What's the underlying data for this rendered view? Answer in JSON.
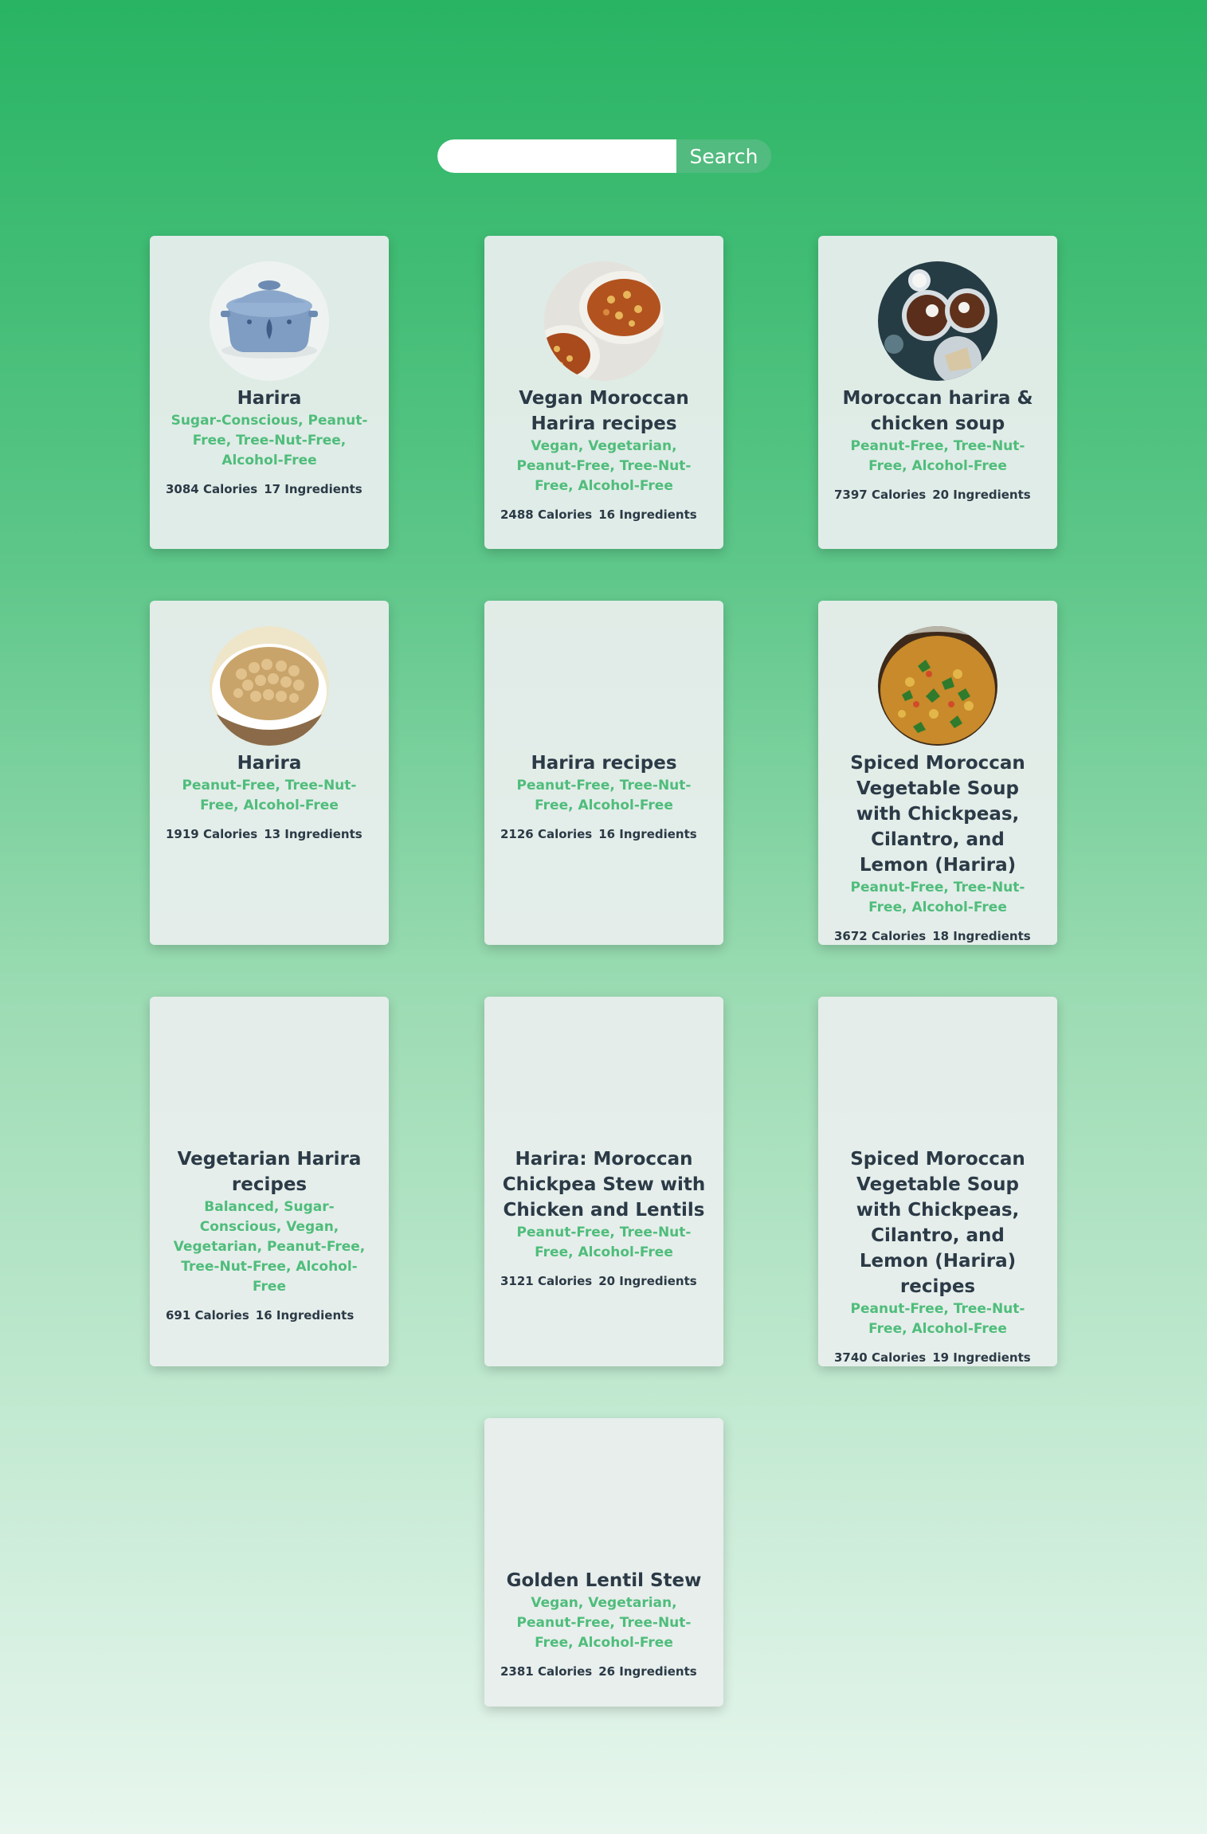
{
  "search": {
    "input_value": "",
    "placeholder": "",
    "button_label": "Search"
  },
  "colors": {
    "background_top": "#28b463",
    "background_bottom": "#e8f6ee",
    "accent_green": "#4fbd7b",
    "title_text": "#2b3a46",
    "card_background": "#e9eeed"
  },
  "recipes": [
    {
      "title": "Harira",
      "tags": "Sugar-Conscious, Peanut-Free, Tree-Nut-Free, Alcohol-Free",
      "calories": "3084 Calories",
      "ingredients": "17 Ingredients",
      "image": "blue-casserole-pot"
    },
    {
      "title": "Vegan Moroccan Harira recipes",
      "tags": "Vegan, Vegetarian, Peanut-Free, Tree-Nut-Free, Alcohol-Free",
      "calories": "2488 Calories",
      "ingredients": "16 Ingredients",
      "image": "chickpea-stew-bowls"
    },
    {
      "title": "Moroccan harira & chicken soup",
      "tags": "Peanut-Free, Tree-Nut-Free, Alcohol-Free",
      "calories": "7397 Calories",
      "ingredients": "20 Ingredients",
      "image": "soup-bowls-overhead"
    },
    {
      "title": "Harira",
      "tags": "Peanut-Free, Tree-Nut-Free, Alcohol-Free",
      "calories": "1919 Calories",
      "ingredients": "13 Ingredients",
      "image": "chickpeas-bowl"
    },
    {
      "title": "Harira recipes",
      "tags": "Peanut-Free, Tree-Nut-Free, Alcohol-Free",
      "calories": "2126 Calories",
      "ingredients": "16 Ingredients",
      "image": ""
    },
    {
      "title": "Spiced Moroccan Vegetable Soup with Chickpeas, Cilantro, and Lemon (Harira)",
      "tags": "Peanut-Free, Tree-Nut-Free, Alcohol-Free",
      "calories": "3672 Calories",
      "ingredients": "18 Ingredients",
      "image": "vegetable-soup-cilantro"
    },
    {
      "title": "Vegetarian Harira recipes",
      "tags": "Balanced, Sugar-Conscious, Vegan, Vegetarian, Peanut-Free, Tree-Nut-Free, Alcohol-Free",
      "calories": "691 Calories",
      "ingredients": "16 Ingredients",
      "image": ""
    },
    {
      "title": "Harira: Moroccan Chickpea Stew with Chicken and Lentils",
      "tags": "Peanut-Free, Tree-Nut-Free, Alcohol-Free",
      "calories": "3121 Calories",
      "ingredients": "20 Ingredients",
      "image": ""
    },
    {
      "title": "Spiced Moroccan Vegetable Soup with Chickpeas, Cilantro, and Lemon (Harira) recipes",
      "tags": "Peanut-Free, Tree-Nut-Free, Alcohol-Free",
      "calories": "3740 Calories",
      "ingredients": "19 Ingredients",
      "image": ""
    },
    {
      "title": "Golden Lentil Stew",
      "tags": "Vegan, Vegetarian, Peanut-Free, Tree-Nut-Free, Alcohol-Free",
      "calories": "2381 Calories",
      "ingredients": "26 Ingredients",
      "image": ""
    }
  ]
}
